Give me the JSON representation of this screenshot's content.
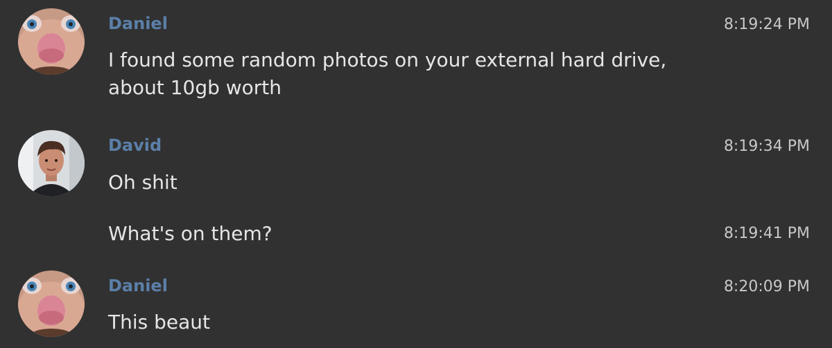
{
  "messages": [
    {
      "author": "Daniel",
      "text": "I found some random photos on your external hard drive, about 10gb worth",
      "time": "8:19:24 PM",
      "avatar": "daniel-avatar"
    },
    {
      "author": "David",
      "text": "Oh shit",
      "time": "8:19:34 PM",
      "avatar": "david-avatar"
    },
    {
      "author": "",
      "text": "What's on them?",
      "time": "8:19:41 PM",
      "avatar": ""
    },
    {
      "author": "Daniel",
      "text": "This beaut",
      "time": "8:20:09 PM",
      "avatar": "daniel-avatar"
    }
  ],
  "colors": {
    "background": "#313131",
    "author": "#5b7fa8",
    "text": "#e6e6e6",
    "time": "#c8c8c8"
  }
}
